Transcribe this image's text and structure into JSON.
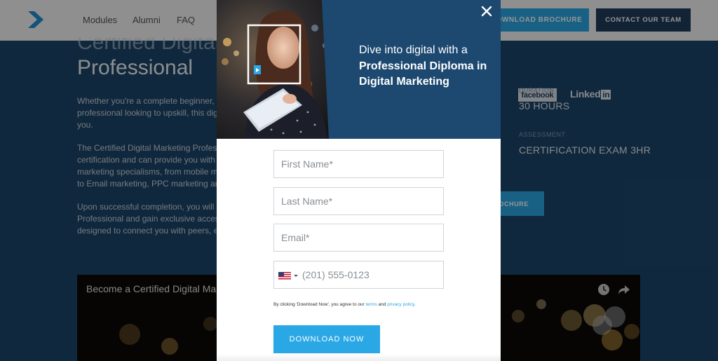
{
  "topbar": {
    "nav": [
      "Modules",
      "Alumni",
      "FAQ"
    ],
    "brochure_label": "DOWNLOAD BROCHURE",
    "brochure_visible": "DOWNLOAD BROCHURE",
    "contact_label": "CONTACT OUR TEAM"
  },
  "hero": {
    "title_line1": "Certified Digital",
    "title_line2": "Professional",
    "paragraphs": [
      [
        "Whether you're a complete beginner,",
        "professional looking to upskill, this dig",
        "you."
      ],
      [
        "The Certified Digital Marketing Profess",
        "certification and can provide you with",
        "marketing specialisms, from mobile m",
        "to Email marketing, PPC marketing an"
      ],
      [
        "Upon successful completion, you will",
        "Professional and gain exclusive access",
        "designed to connect you with peers, e"
      ]
    ]
  },
  "sidebar": {
    "facebook": "facebook",
    "linkedin_text": "Linked",
    "linkedin_in": "in",
    "duration_label": "DURATION",
    "duration_value": "30 HOURS",
    "assessment_label": "ASSESSMENT",
    "assessment_value": "CERTIFICATION EXAM 3HR",
    "brochure_btn": "OCHURE"
  },
  "video": {
    "title": "Become a Certified Digital Ma"
  },
  "modal": {
    "headline_intro": "Dive into digital with a",
    "headline_bold_1": "Professional Diploma in",
    "headline_bold_2": "Digital Marketing",
    "first_name_placeholder": "First Name*",
    "last_name_placeholder": "Last Name*",
    "email_placeholder": "Email*",
    "phone_placeholder": "(201) 555-0123",
    "consent_prefix": "By clicking 'Download Now', you agree to our",
    "terms_link": "terms",
    "consent_and": "and",
    "privacy_link": "privacy policy",
    "consent_suffix": ".",
    "submit_label": "DOWNLOAD NOW"
  },
  "colors": {
    "accent": "#2aa8e6",
    "navy": "#1d4971",
    "contact_button": "#1f3d5c"
  },
  "icons": {
    "logo": "chevron-logo-icon",
    "close": "close-icon",
    "flag": "us-flag-icon",
    "watch_later": "clock-icon",
    "share": "share-icon"
  }
}
